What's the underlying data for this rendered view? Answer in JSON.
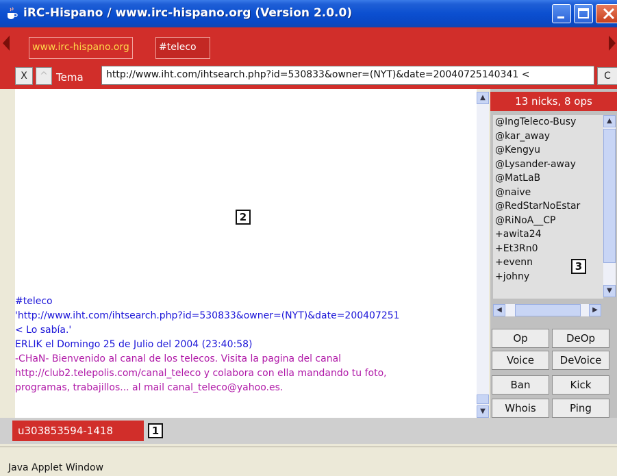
{
  "window": {
    "title": "iRC-Hispano / www.irc-hispano.org (Version 2.0.0)",
    "controls": [
      "minimize-icon",
      "maximize-icon",
      "close-icon"
    ]
  },
  "tabs": [
    {
      "label": "www.irc-hispano.org"
    },
    {
      "label": "#teleco"
    }
  ],
  "topic": {
    "close_label": "X",
    "caret_label": "^",
    "label": "Tema",
    "value": "http://www.iht.com/ihtsearch.php?id=530833&owner=(NYT)&date=20040725140341 <",
    "c_label": "C"
  },
  "chat": {
    "lines": [
      {
        "text": "  #teleco",
        "color": "blue"
      },
      {
        "text": "    'http://www.iht.com/ihtsearch.php?id=530833&owner=(NYT)&date=200407251",
        "color": "blue"
      },
      {
        "text": "    < Lo sabía.'",
        "color": "blue"
      },
      {
        "text": "  ERLIK el Domingo 25 de Julio del 2004 (23:40:58)",
        "color": "blue"
      },
      {
        "text": " -CHaN- Bienvenido al canal de los telecos. Visita la pagina del canal",
        "color": "magenta"
      },
      {
        "text": "     http://club2.telepolis.com/canal_teleco y colabora con ella mandando tu foto,",
        "color": "magenta"
      },
      {
        "text": "     programas, trabajillos... al mail canal_teleco@yahoo.es.",
        "color": "magenta"
      }
    ]
  },
  "nicks": {
    "header": "13 nicks, 8 ops",
    "items": [
      "@IngTeleco-Busy",
      "@kar_away",
      "@Kengyu",
      "@Lysander-away",
      "@MatLaB",
      "@naive",
      "@RedStarNoEstar",
      "@RiNoA__CP",
      "+awita24",
      "+Et3Rn0",
      "+evenn",
      "+johny"
    ]
  },
  "actions": {
    "op": "Op",
    "deop": "DeOp",
    "voice": "Voice",
    "devoice": "DeVoice",
    "ban": "Ban",
    "kick": "Kick",
    "whois": "Whois",
    "ping": "Ping"
  },
  "status": {
    "my_nick": "u303853594-1418",
    "applet_text": "Java Applet Window"
  },
  "callouts": {
    "one": "1",
    "two": "2",
    "three": "3"
  },
  "colors": {
    "accent_red": "#d12e2a",
    "chat_blue": "#1a14d8",
    "chat_magenta": "#b01aa8",
    "server_tab_yellow": "#ffd84a"
  }
}
